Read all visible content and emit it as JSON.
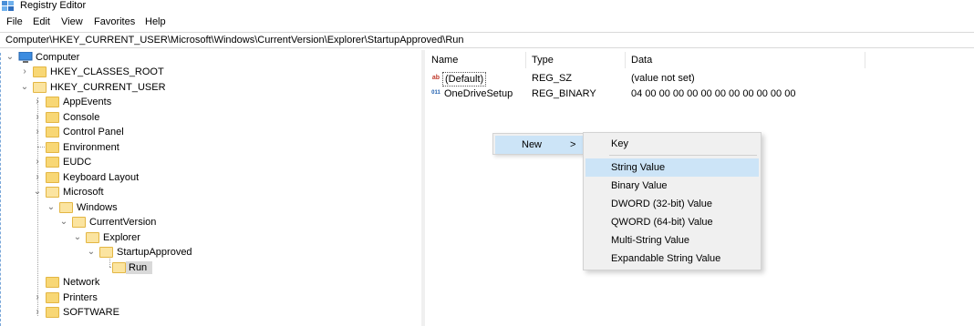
{
  "window": {
    "title": "Registry Editor"
  },
  "menu": [
    "File",
    "Edit",
    "View",
    "Favorites",
    "Help"
  ],
  "address": "Computer\\HKEY_CURRENT_USER\\Microsoft\\Windows\\CurrentVersion\\Explorer\\StartupApproved\\Run",
  "tree": {
    "computer": "Computer",
    "hkcr": "HKEY_CLASSES_ROOT",
    "hkcu": "HKEY_CURRENT_USER",
    "appevents": "AppEvents",
    "console": "Console",
    "control_panel": "Control Panel",
    "environment": "Environment",
    "eudc": "EUDC",
    "keyboard_layout": "Keyboard Layout",
    "microsoft": "Microsoft",
    "windows": "Windows",
    "current_version": "CurrentVersion",
    "explorer": "Explorer",
    "startup_approved": "StartupApproved",
    "run": "Run",
    "network": "Network",
    "printers": "Printers",
    "software": "SOFTWARE"
  },
  "columns": {
    "name": "Name",
    "type": "Type",
    "data": "Data"
  },
  "values": [
    {
      "icon": "string-value-icon",
      "glyph": "ab",
      "name": "(Default)",
      "type": "REG_SZ",
      "data": "(value not set)"
    },
    {
      "icon": "binary-value-icon",
      "glyph": "011",
      "name": "OneDriveSetup",
      "type": "REG_BINARY",
      "data": "04 00 00 00 00 00 00 00 00 00 00 00"
    }
  ],
  "context_menu": {
    "new_label": "New",
    "arrow": ">"
  },
  "submenu": {
    "items": [
      "Key",
      "String Value",
      "Binary Value",
      "DWORD (32-bit) Value",
      "QWORD (64-bit) Value",
      "Multi-String Value",
      "Expandable String Value"
    ],
    "highlighted": "String Value"
  },
  "colors": {
    "selection": "#cce4f7",
    "folder": "#f8d775",
    "tree_selected": "#d9d9d9"
  }
}
